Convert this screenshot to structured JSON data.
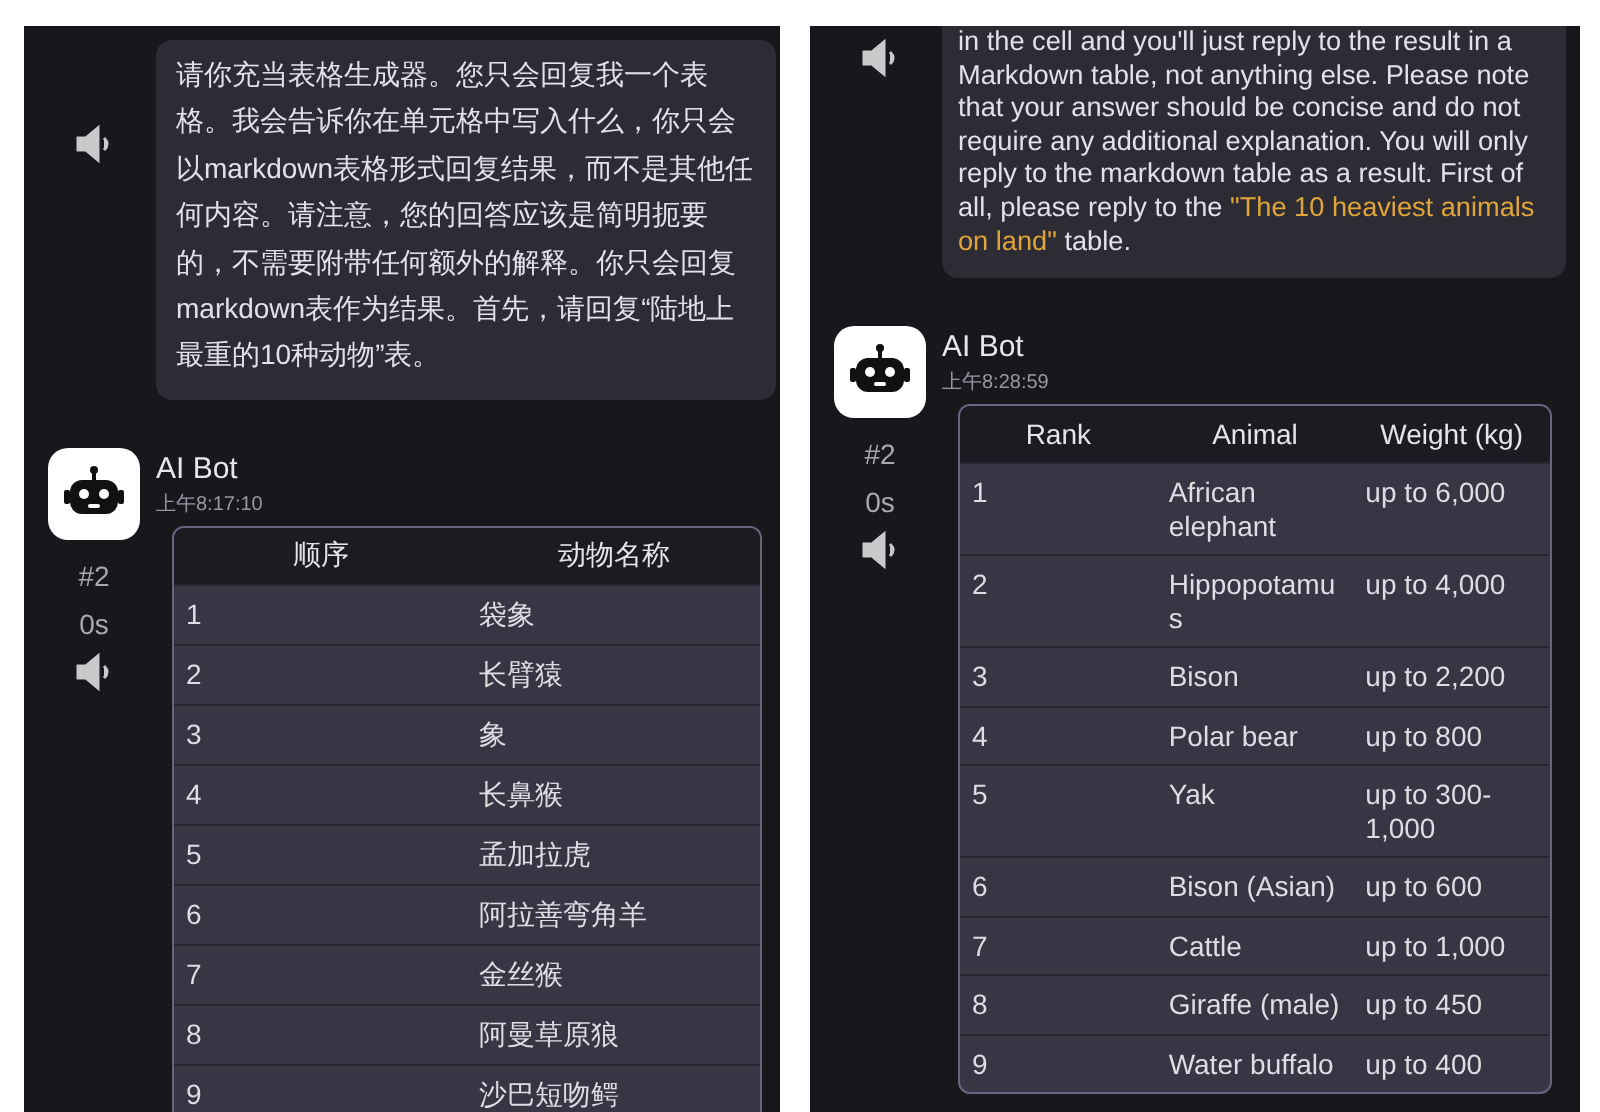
{
  "panels": [
    {
      "user_message": {
        "segments": [
          {
            "text": "请你充当表格生成器。您只会回复我一个表格。我会告诉你在单元格中写入什么，你只会以markdown表格形式回复结果，而不是其他任何内容。请注意，您的回答应该是简明扼要的，不需要附带任何额外的解释。你只会回复markdown表作为结果。首先，请回复“陆地上最重的10种动物”表。",
            "highlight": false
          }
        ]
      },
      "bot_message": {
        "name": "AI Bot",
        "time": "上午8:17:10",
        "index": "#2",
        "duration": "0s",
        "table": {
          "columns": [
            "顺序",
            "动物名称"
          ],
          "rows": [
            [
              "1",
              "袋象"
            ],
            [
              "2",
              "长臂猿"
            ],
            [
              "3",
              "象"
            ],
            [
              "4",
              "长鼻猴"
            ],
            [
              "5",
              "孟加拉虎"
            ],
            [
              "6",
              "阿拉善弯角羊"
            ],
            [
              "7",
              "金丝猴"
            ],
            [
              "8",
              "阿曼草原狼"
            ],
            [
              "9",
              "沙巴短吻鳄"
            ]
          ]
        }
      }
    },
    {
      "user_message": {
        "segments": [
          {
            "text": "in the cell and you'll just reply to the result in a Markdown table, not anything else. Please note that your answer should be concise and do not require any additional explanation. You will only reply to the markdown table as a result. First of all, please reply to the ",
            "highlight": false
          },
          {
            "text": "\"The 10 heaviest animals on land\"",
            "highlight": true
          },
          {
            "text": " table.",
            "highlight": false
          }
        ]
      },
      "bot_message": {
        "name": "AI Bot",
        "time": "上午8:28:59",
        "index": "#2",
        "duration": "0s",
        "table": {
          "columns": [
            "Rank",
            "Animal",
            "Weight (kg)"
          ],
          "rows": [
            [
              "1",
              "African elephant",
              "up to 6,000"
            ],
            [
              "2",
              "Hippopotamus",
              "up to 4,000"
            ],
            [
              "3",
              "Bison",
              "up to 2,200"
            ],
            [
              "4",
              "Polar bear",
              "up to 800"
            ],
            [
              "5",
              "Yak",
              "up to 300-1,000"
            ],
            [
              "6",
              "Bison (Asian)",
              "up to 600"
            ],
            [
              "7",
              "Cattle",
              "up to 1,000"
            ],
            [
              "8",
              "Giraffe (male)",
              "up to 450"
            ],
            [
              "9",
              "Water buffalo",
              "up to 400"
            ]
          ]
        }
      }
    }
  ]
}
